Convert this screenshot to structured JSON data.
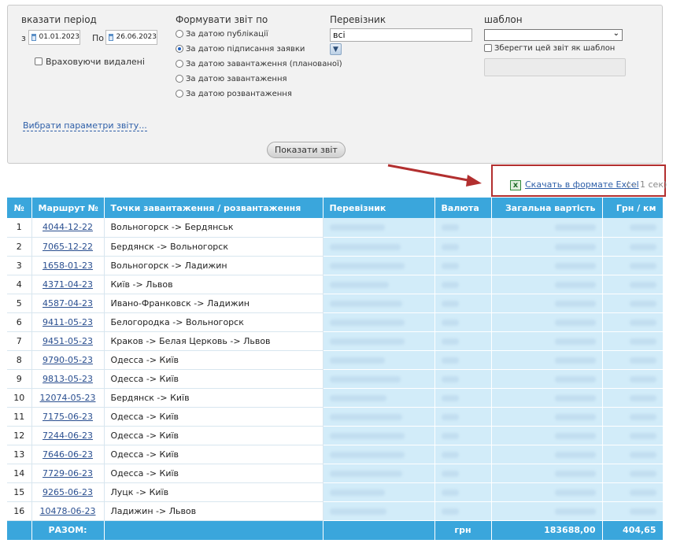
{
  "filters": {
    "period_label": "вказати період",
    "from_label": "з",
    "from_date": "01.01.2023",
    "to_label": "По",
    "to_date": "26.06.2023",
    "include_deleted_label": "Враховуючи видалені",
    "form_report_label": "Формувати звіт по",
    "options": [
      {
        "label": "За датою публікації",
        "selected": false
      },
      {
        "label": "За датою підписання заявки",
        "selected": true
      },
      {
        "label": "За датою завантаження (планованої)",
        "selected": false
      },
      {
        "label": "За датою завантаження",
        "selected": false
      },
      {
        "label": "За датою розвантаження",
        "selected": false
      }
    ],
    "carrier_label": "Перевізник",
    "carrier_value": "всі",
    "template_label": "шаблон",
    "template_value": "",
    "save_template_label": "Зберегти цей звіт як шаблон",
    "choose_params_link": "Вибрати параметри звіту...",
    "show_report_button": "Показати звіт"
  },
  "export": {
    "excel_link": "Скачать в формате Excel",
    "excel_note": "(~ 1 сек)"
  },
  "table": {
    "headers": {
      "num": "№",
      "route": "Маршрут №",
      "points": "Точки завантаження / розвантаження",
      "carrier": "Перевізник",
      "currency": "Валюта",
      "total": "Загальна вартість",
      "per_km": "Грн / км"
    },
    "rows": [
      {
        "num": "1",
        "route": "4044-12-22",
        "points": "Вольногорск -> Бердянськ"
      },
      {
        "num": "2",
        "route": "7065-12-22",
        "points": "Бердянск -> Вольногорск"
      },
      {
        "num": "3",
        "route": "1658-01-23",
        "points": "Вольногорск -> Ладижин"
      },
      {
        "num": "4",
        "route": "4371-04-23",
        "points": "Київ -> Львов"
      },
      {
        "num": "5",
        "route": "4587-04-23",
        "points": "Ивано-Франковск -> Ладижин"
      },
      {
        "num": "6",
        "route": "9411-05-23",
        "points": "Белогородка -> Вольногорск"
      },
      {
        "num": "7",
        "route": "9451-05-23",
        "points": "Краков -> Белая Церковь -> Львов"
      },
      {
        "num": "8",
        "route": "9790-05-23",
        "points": "Одесса -> Київ"
      },
      {
        "num": "9",
        "route": "9813-05-23",
        "points": "Одесса -> Київ"
      },
      {
        "num": "10",
        "route": "12074-05-23",
        "points": "Бердянск -> Київ"
      },
      {
        "num": "11",
        "route": "7175-06-23",
        "points": "Одесса -> Київ"
      },
      {
        "num": "12",
        "route": "7244-06-23",
        "points": "Одесса -> Київ"
      },
      {
        "num": "13",
        "route": "7646-06-23",
        "points": "Одесса -> Київ"
      },
      {
        "num": "14",
        "route": "7729-06-23",
        "points": "Одесса -> Київ"
      },
      {
        "num": "15",
        "route": "9265-06-23",
        "points": "Луцк -> Київ"
      },
      {
        "num": "16",
        "route": "10478-06-23",
        "points": "Ладижин -> Львов"
      }
    ],
    "totals": {
      "label": "РАЗОМ:",
      "currency": "грн",
      "total": "183688,00",
      "per_km": "404,65"
    }
  },
  "colors": {
    "header_bg": "#3aa6dc",
    "blurred_cell_bg": "#d2ecf9",
    "highlight_border": "#b22f2f",
    "link": "#2a4f90"
  }
}
